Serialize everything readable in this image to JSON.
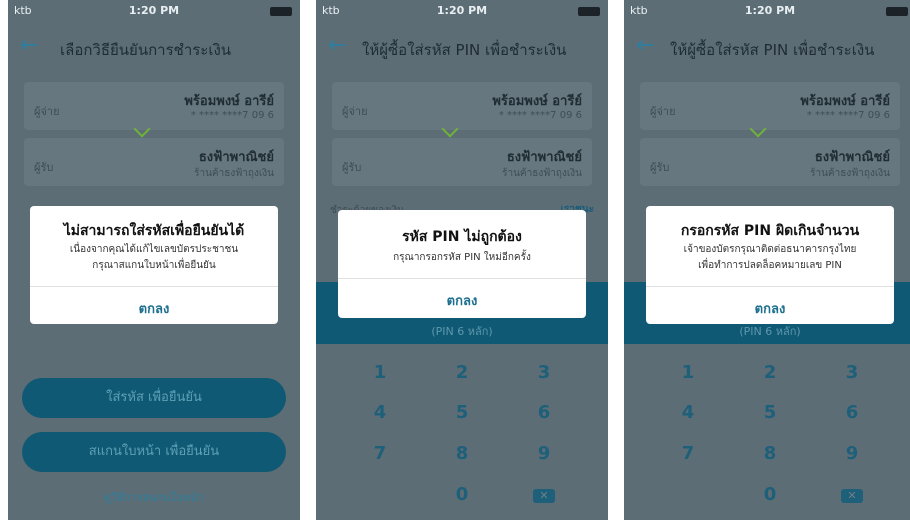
{
  "status": {
    "carrier": "ktb",
    "time": "1:20 PM"
  },
  "phones": [
    {
      "title": "เลือกวิธียืนยันการชำระเงิน",
      "payer_label": "ผู้จ่าย",
      "payer_name": "พร้อมพงษ์ อารีย์",
      "payer_acct": "* **** ****7 09 6",
      "payee_label": "ผู้รับ",
      "payee_name": "ธงฟ้าพาณิชย์",
      "payee_sub": "ร้านค้าธงฟ้าถุงเงิน",
      "btn_pin": "ใส่รหัส เพื่อยืนยัน",
      "btn_scan": "สแกนใบหน้า เพื่อยืนยัน",
      "link": "ดูวิธีการสแกนใบหน้า",
      "dialog": {
        "title": "ไม่สามารถใส่รหัสเพื่อยืนยันได้",
        "line1": "เนื่องจากคุณได้แก้ไขเลขบัตรประชาชน",
        "line2": "กรุณาสแกนใบหน้าเพื่อยืนยัน",
        "ok": "ตกลง"
      }
    },
    {
      "title": "ให้ผู้ซื้อใส่รหัส PIN เพื่อชำระเงิน",
      "payer_label": "ผู้จ่าย",
      "payer_name": "พร้อมพงษ์ อารีย์",
      "payer_acct": "* **** ****7 09 6",
      "payee_label": "ผู้รับ",
      "payee_name": "ธงฟ้าพาณิชย์",
      "payee_sub": "ร้านค้าธงฟ้าถุงเงิน",
      "peek_left": "ชำระด้วยของเงิน",
      "peek_right": "เราชนะ",
      "pin_label": "(PIN 6 หลัก)",
      "keys": [
        "1",
        "2",
        "3",
        "4",
        "5",
        "6",
        "7",
        "8",
        "9",
        "0"
      ],
      "del": "✕",
      "dialog": {
        "title": "รหัส PIN ไม่ถูกต้อง",
        "line1": "กรุณากรอกรหัส PIN ใหม่อีกครั้ง",
        "ok": "ตกลง"
      }
    },
    {
      "title": "ให้ผู้ซื้อใส่รหัส PIN เพื่อชำระเงิน",
      "payer_label": "ผู้จ่าย",
      "payer_name": "พร้อมพงษ์ อารีย์",
      "payer_acct": "* **** ****7 09 6",
      "payee_label": "ผู้รับ",
      "payee_name": "ธงฟ้าพาณิชย์",
      "payee_sub": "ร้านค้าธงฟ้าถุงเงิน",
      "pin_label": "(PIN 6 หลัก)",
      "keys": [
        "1",
        "2",
        "3",
        "4",
        "5",
        "6",
        "7",
        "8",
        "9",
        "0"
      ],
      "del": "✕",
      "dialog": {
        "title": "กรอกรหัส PIN ผิดเกินจำนวน",
        "line1": "เจ้าของบัตรกรุณาติดต่อธนาคารกรุงไทย",
        "line2": "เพื่อทำการปลดล็อคหมายเลข PIN",
        "ok": "ตกลง"
      }
    }
  ]
}
